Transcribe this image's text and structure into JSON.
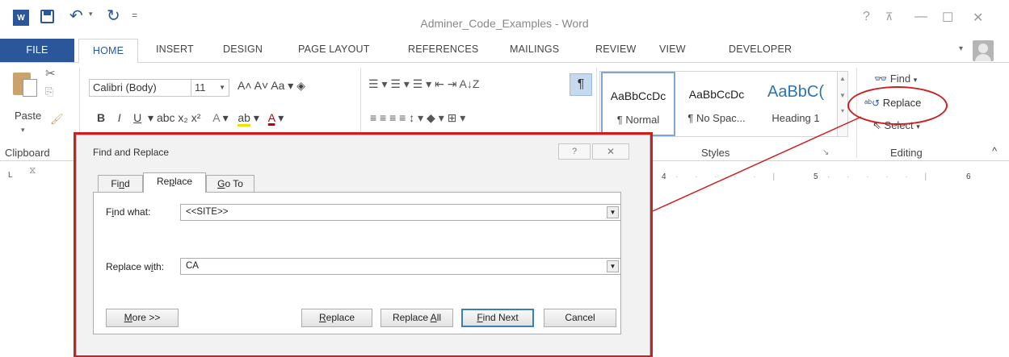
{
  "window": {
    "title": "Adminer_Code_Examples - Word",
    "help": "?",
    "ribbon_display": "⊼",
    "minimize": "—",
    "maximize": "☐",
    "close": "✕"
  },
  "quick_access": {
    "app_badge": "W",
    "undo": "↶",
    "undo_dropdown": "▾",
    "redo": "↻",
    "customize": "="
  },
  "tabs": [
    "FILE",
    "HOME",
    "INSERT",
    "DESIGN",
    "PAGE LAYOUT",
    "REFERENCES",
    "MAILINGS",
    "REVIEW",
    "VIEW",
    "DEVELOPER"
  ],
  "account_caret": "▾",
  "ribbon": {
    "clipboard": {
      "paste_label": "Paste",
      "paste_caret": "▾",
      "cut_glyph": "✂",
      "copy_glyph": "⎘",
      "painter_glyph": "🖌",
      "group_label": "Clipboard"
    },
    "font": {
      "font_name": "Calibri (Body)",
      "font_size": "11",
      "row1": "A˄ A˅  Aa ▾  ◈",
      "row2_bold": "B",
      "row2_italic": "I",
      "row2_underline": "U",
      "row2_rest": "▾  abc  x₂  x²",
      "text_effects": "A",
      "highlight": "ab",
      "font_color": "A"
    },
    "paragraph": {
      "row1": "☰ ▾  ☰ ▾  ☰ ▾  ⇤ ⇥  A↓Z",
      "pilcrow": "¶",
      "row2": "≡  ≡  ≡  ≡   ↕ ▾   ◆ ▾  ⊞ ▾"
    },
    "styles": {
      "items": [
        {
          "sample": "AaBbCcDc",
          "name": "¶ Normal",
          "selected": true
        },
        {
          "sample": "AaBbCcDc",
          "name": "¶ No Spac...",
          "selected": false
        },
        {
          "sample": "AaBbC(",
          "name": "Heading 1",
          "selected": false
        }
      ],
      "scroll_up": "▲",
      "scroll_down": "▼",
      "more": "▾",
      "group_label": "Styles",
      "launcher": "↘"
    },
    "editing": {
      "find_label": "Find",
      "find_caret": "▾",
      "replace_label": "Replace",
      "select_label": "Select",
      "select_caret": "▾",
      "group_label": "Editing"
    },
    "collapse": "^"
  },
  "ruler": {
    "tab_selector": "L",
    "indent_marker": "⧖",
    "numbers": [
      "4",
      "5",
      "6"
    ]
  },
  "dialog": {
    "title": "Find and Replace",
    "help_glyph": "?",
    "close_glyph": "✕",
    "tabs": [
      {
        "pre": "Fi",
        "accel": "n",
        "post": "d",
        "active": false
      },
      {
        "pre": "Re",
        "accel": "p",
        "post": "lace",
        "active": true
      },
      {
        "pre": "",
        "accel": "G",
        "post": "o To",
        "active": false
      }
    ],
    "find_label_pre": "F",
    "find_label_accel": "i",
    "find_label_post": "nd what:",
    "find_value": "<<SITE>>",
    "replace_label_pre": "Replace w",
    "replace_label_accel": "i",
    "replace_label_post": "th:",
    "replace_value": "CA",
    "combo_arrow": "▼",
    "buttons": {
      "more_pre": "",
      "more_accel": "M",
      "more_post": "ore >>",
      "replace_pre": "",
      "replace_accel": "R",
      "replace_post": "eplace",
      "replace_all_pre": "Replace ",
      "replace_all_accel": "A",
      "replace_all_post": "ll",
      "find_next_pre": "",
      "find_next_accel": "F",
      "find_next_post": "ind Next",
      "cancel": "Cancel"
    }
  },
  "colors": {
    "word_blue": "#2b579a",
    "annotation_red": "#cc1f1f",
    "default_button_border": "#3c7fb1"
  }
}
